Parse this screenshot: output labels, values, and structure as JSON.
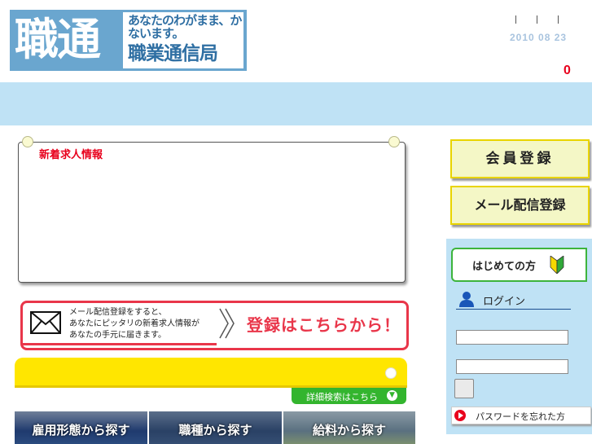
{
  "header": {
    "logo_kanji": "職通",
    "logo_tagline": "あなたのわがまま、かないます。",
    "logo_name": "職業通信局",
    "date": "2010 08 23",
    "counter": "0"
  },
  "news": {
    "title": "新着求人情報"
  },
  "mail_banner": {
    "text": "メール配信登録をすると、あなたにピッタリの新着求人情報があなたの手元に届きます。",
    "text_lines": [
      "メール配信登録をすると、",
      "あなたにピッタリの新着求人情報が",
      "あなたの手元に届きます。"
    ],
    "cta": "登録はこちらから！"
  },
  "search": {
    "detail_label": "詳細検索はこちら"
  },
  "tabs": [
    "雇用形態から探す",
    "職種から探す",
    "給料から探す"
  ],
  "sidebar": {
    "register": "会員登録",
    "mail_register": "メール配信登録",
    "first_time": "はじめての方",
    "login": "ログイン",
    "forgot_password": "パスワードを忘れた方"
  },
  "colors": {
    "brand_blue": "#6aa6cf",
    "band": "#bfe2f5",
    "accent_red": "#e9364a",
    "yellow": "#ffe600",
    "green": "#33b52e"
  }
}
